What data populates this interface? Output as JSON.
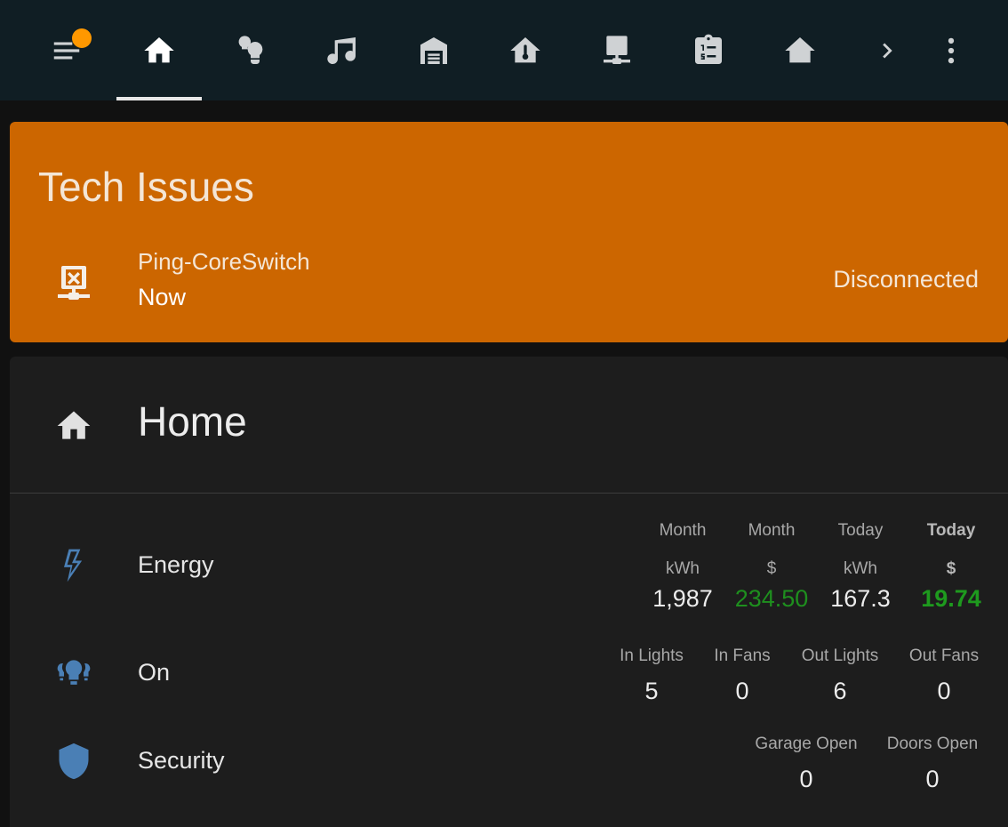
{
  "toolbar": {
    "items": [
      {
        "icon": "menu-icon",
        "badge": true
      },
      {
        "icon": "home-icon",
        "active": true
      },
      {
        "icon": "lightbulb-group-icon"
      },
      {
        "icon": "music-note-icon"
      },
      {
        "icon": "garage-icon"
      },
      {
        "icon": "home-thermometer-icon"
      },
      {
        "icon": "server-network-icon"
      },
      {
        "icon": "clipboard-list-icon"
      },
      {
        "icon": "home-lightning-icon"
      },
      {
        "icon": "chevron-right-icon"
      },
      {
        "icon": "dots-vertical-icon"
      }
    ]
  },
  "issues_card": {
    "title": "Tech Issues",
    "color": "#cc6600",
    "entry": {
      "icon": "server-off-icon",
      "name": "Ping-CoreSwitch",
      "time": "Now",
      "state": "Disconnected"
    }
  },
  "home_card": {
    "icon": "home-icon",
    "title": "Home",
    "rows": {
      "energy": {
        "icon": "lightning-bolt-icon",
        "label": "Energy",
        "attrs": [
          {
            "h1": "Month",
            "h2": "kWh",
            "value": "1,987"
          },
          {
            "h1": "Month",
            "h2": "$",
            "value": "234.50"
          },
          {
            "h1": "Today",
            "h2": "kWh",
            "value": "167.3"
          },
          {
            "h1": "Today",
            "h2": "$",
            "value": "19.74"
          }
        ]
      },
      "on": {
        "icon": "lightbulb-group-icon",
        "label": "On",
        "attrs": [
          {
            "h1": "In Lights",
            "value": "5"
          },
          {
            "h1": "In Fans",
            "value": "0"
          },
          {
            "h1": "Out Lights",
            "value": "6"
          },
          {
            "h1": "Out Fans",
            "value": "0"
          }
        ]
      },
      "security": {
        "icon": "shield-icon",
        "label": "Security",
        "attrs": [
          {
            "h1": "Garage Open",
            "value": "0"
          },
          {
            "h1": "Doors Open",
            "value": "0"
          }
        ]
      }
    }
  },
  "colors": {
    "toolbar_bg": "#101e24",
    "badge": "#ff9800",
    "icon_blue": "#4a7fb5",
    "money_green": "#1e8f1e"
  }
}
